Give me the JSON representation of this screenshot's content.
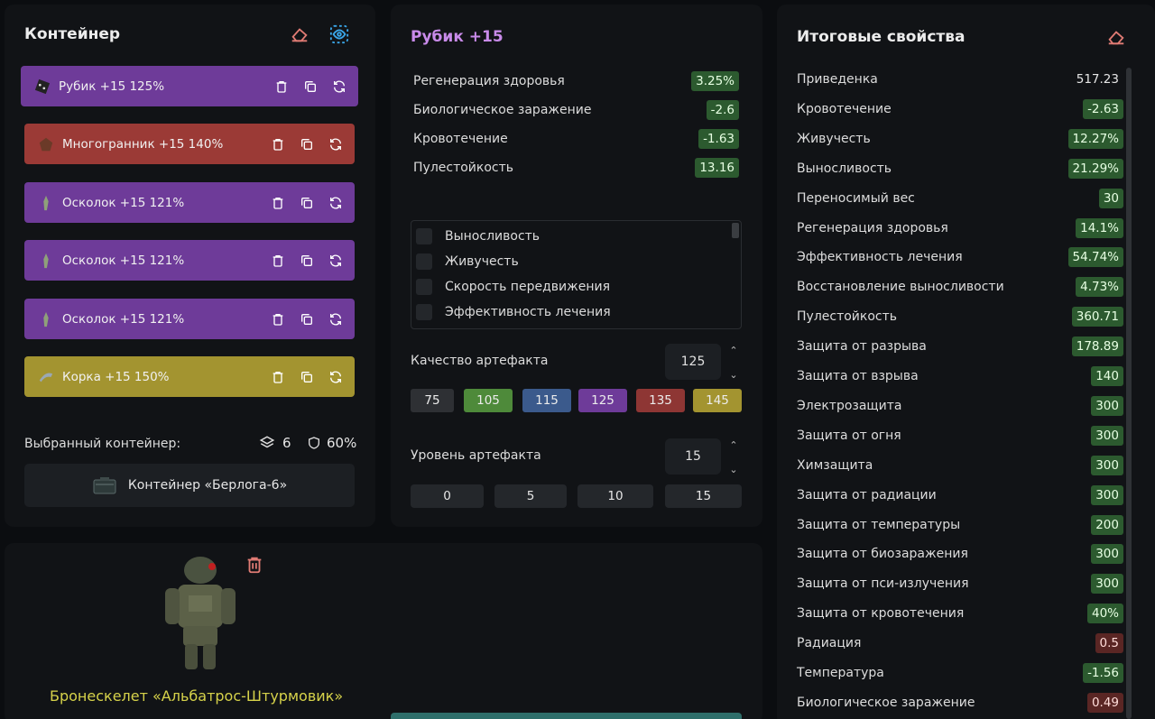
{
  "container_panel": {
    "title": "Контейнер",
    "items": [
      {
        "label": "Рубик +15 125%",
        "color": "purple",
        "icon": "rubik-artifact-icon"
      },
      {
        "label": "Многогранник +15 140%",
        "color": "red",
        "icon": "polyhedron-artifact-icon"
      },
      {
        "label": "Осколок +15 121%",
        "color": "purple",
        "icon": "shard-artifact-icon"
      },
      {
        "label": "Осколок +15 121%",
        "color": "purple",
        "icon": "shard-artifact-icon"
      },
      {
        "label": "Осколок +15 121%",
        "color": "purple",
        "icon": "shard-artifact-icon"
      },
      {
        "label": "Корка +15 150%",
        "color": "olive",
        "icon": "crust-artifact-icon"
      }
    ],
    "selected_label": "Выбранный контейнер:",
    "slots_count": "6",
    "protection": "60%",
    "container_name": "Контейнер «Берлога-6»"
  },
  "artifact_panel": {
    "title": "Рубик +15",
    "stats": [
      {
        "label": "Регенерация здоровья",
        "value": "3.25%"
      },
      {
        "label": "Биологическое заражение",
        "value": "-2.6"
      },
      {
        "label": "Кровотечение",
        "value": "-1.63"
      },
      {
        "label": "Пулестойкость",
        "value": "13.16"
      }
    ],
    "checkbox_options": [
      "Выносливость",
      "Живучесть",
      "Скорость передвижения",
      "Эффективность лечения"
    ],
    "quality_label": "Качество артефакта",
    "quality_value": "125",
    "quality_presets": [
      "75",
      "105",
      "115",
      "125",
      "135",
      "145"
    ],
    "level_label": "Уровень артефакта",
    "level_value": "15",
    "level_presets": [
      "0",
      "5",
      "10",
      "15"
    ]
  },
  "armor_panel": {
    "name": "Бронескелет «Альбатрос-Штурмовик»"
  },
  "total_panel": {
    "title": "Итоговые свойства",
    "stats": [
      {
        "label": "Приведенка",
        "value": "517.23",
        "style": "plain"
      },
      {
        "label": "Кровотечение",
        "value": "-2.63",
        "style": "green"
      },
      {
        "label": "Живучесть",
        "value": "12.27%",
        "style": "green"
      },
      {
        "label": "Выносливость",
        "value": "21.29%",
        "style": "green"
      },
      {
        "label": "Переносимый вес",
        "value": "30",
        "style": "green"
      },
      {
        "label": "Регенерация здоровья",
        "value": "14.1%",
        "style": "green"
      },
      {
        "label": "Эффективность лечения",
        "value": "54.74%",
        "style": "green"
      },
      {
        "label": "Восстановление выносливости",
        "value": "4.73%",
        "style": "green"
      },
      {
        "label": "Пулестойкость",
        "value": "360.71",
        "style": "green"
      },
      {
        "label": "Защита от разрыва",
        "value": "178.89",
        "style": "green"
      },
      {
        "label": "Защита от взрыва",
        "value": "140",
        "style": "green"
      },
      {
        "label": "Электрозащита",
        "value": "300",
        "style": "green"
      },
      {
        "label": "Защита от огня",
        "value": "300",
        "style": "green"
      },
      {
        "label": "Химзащита",
        "value": "300",
        "style": "green"
      },
      {
        "label": "Защита от радиации",
        "value": "300",
        "style": "green"
      },
      {
        "label": "Защита от температуры",
        "value": "200",
        "style": "green"
      },
      {
        "label": "Защита от биозаражения",
        "value": "300",
        "style": "green"
      },
      {
        "label": "Защита от пси-излучения",
        "value": "300",
        "style": "green"
      },
      {
        "label": "Защита от кровотечения",
        "value": "40%",
        "style": "green"
      },
      {
        "label": "Радиация",
        "value": "0.5",
        "style": "red"
      },
      {
        "label": "Температура",
        "value": "-1.56",
        "style": "green"
      },
      {
        "label": "Биологическое заражение",
        "value": "0.49",
        "style": "red"
      }
    ]
  },
  "colors": {
    "purple": "#6e3b99",
    "red": "#9b3a36",
    "olive": "#a39430",
    "accent_title": "#c98bea",
    "armor_name": "#d6d24a",
    "eraser": "#e07b74",
    "eye": "#3aa6e8"
  }
}
